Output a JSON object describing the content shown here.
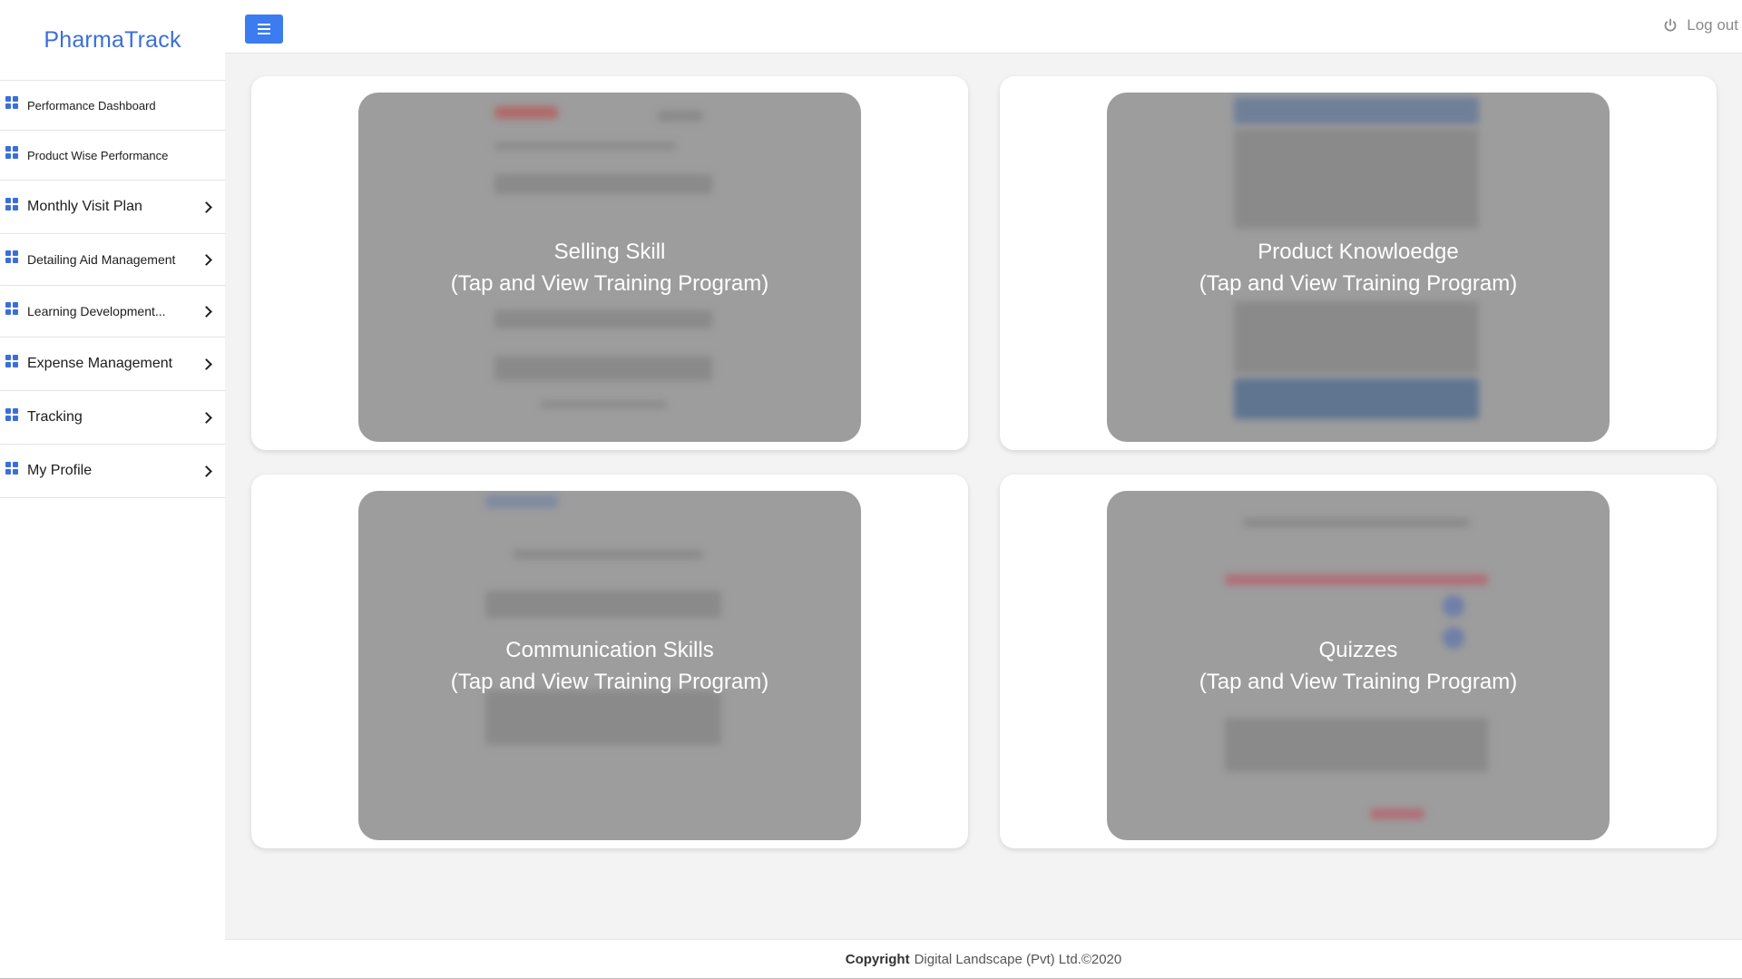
{
  "app": {
    "brand": "PharmaTrack"
  },
  "sidebar": {
    "items": [
      {
        "label": "Performance Dashboard"
      },
      {
        "label": "Product Wise Performance"
      },
      {
        "label": "Monthly Visit Plan"
      },
      {
        "label": "Detailing Aid Management"
      },
      {
        "label": "Learning Development..."
      },
      {
        "label": "Expense Management"
      },
      {
        "label": "Tracking"
      },
      {
        "label": "My Profile"
      }
    ]
  },
  "topbar": {
    "logout_label": "Log out"
  },
  "cards": [
    {
      "title": "Selling Skill",
      "subtitle": "(Tap and View Training Program)"
    },
    {
      "title": "Product Knowloedge",
      "subtitle": "(Tap and View Training Program)"
    },
    {
      "title": "Communication Skills",
      "subtitle": "(Tap and View Training Program)"
    },
    {
      "title": "Quizzes",
      "subtitle": "(Tap and View Training Program)"
    }
  ],
  "footer": {
    "copyright_label": "Copyright",
    "company": "Digital Landscape (Pvt) Ltd.©2020"
  },
  "colors": {
    "accent": "#3b6fd8",
    "button": "#3b7cf0",
    "overlay": "#9d9d9d"
  }
}
